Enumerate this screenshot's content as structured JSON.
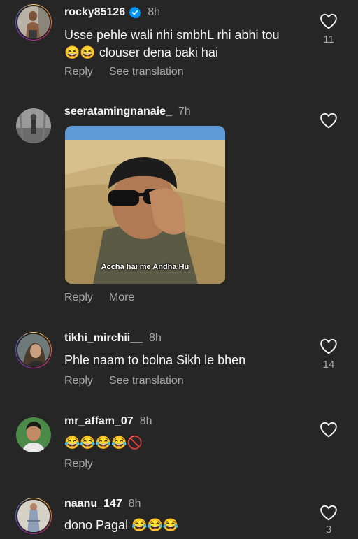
{
  "comments": [
    {
      "username": "rocky85126",
      "verified": true,
      "time": "8h",
      "text_line1": "Usse pehle wali nhi smbhL rhi abhi tou",
      "emoji": "😆😆",
      "text_line2": " clouser dena baki hai",
      "reply": "Reply",
      "translate": "See translation",
      "likes": "11"
    },
    {
      "username": "seeratamingnanaie_",
      "time": "7h",
      "gif_caption": "Accha hai me Andha Hu",
      "reply": "Reply",
      "more": "More"
    },
    {
      "username": "tikhi_mirchii__",
      "time": "8h",
      "text": "Phle naam to bolna Sikh le bhen",
      "reply": "Reply",
      "translate": "See translation",
      "likes": "14"
    },
    {
      "username": "mr_affam_07",
      "time": "8h",
      "emoji": "😂😂😂😂🚫",
      "reply": "Reply"
    },
    {
      "username": "naanu_147",
      "time": "8h",
      "text": "dono Pagal ",
      "emoji": "😂😂😂",
      "likes": "3"
    }
  ],
  "icons": {
    "like": "heart-outline-icon",
    "verified": "verified-badge-icon"
  },
  "colors": {
    "background": "#262626",
    "verified": "#0095f6",
    "secondary_text": "#a8a8a8"
  }
}
